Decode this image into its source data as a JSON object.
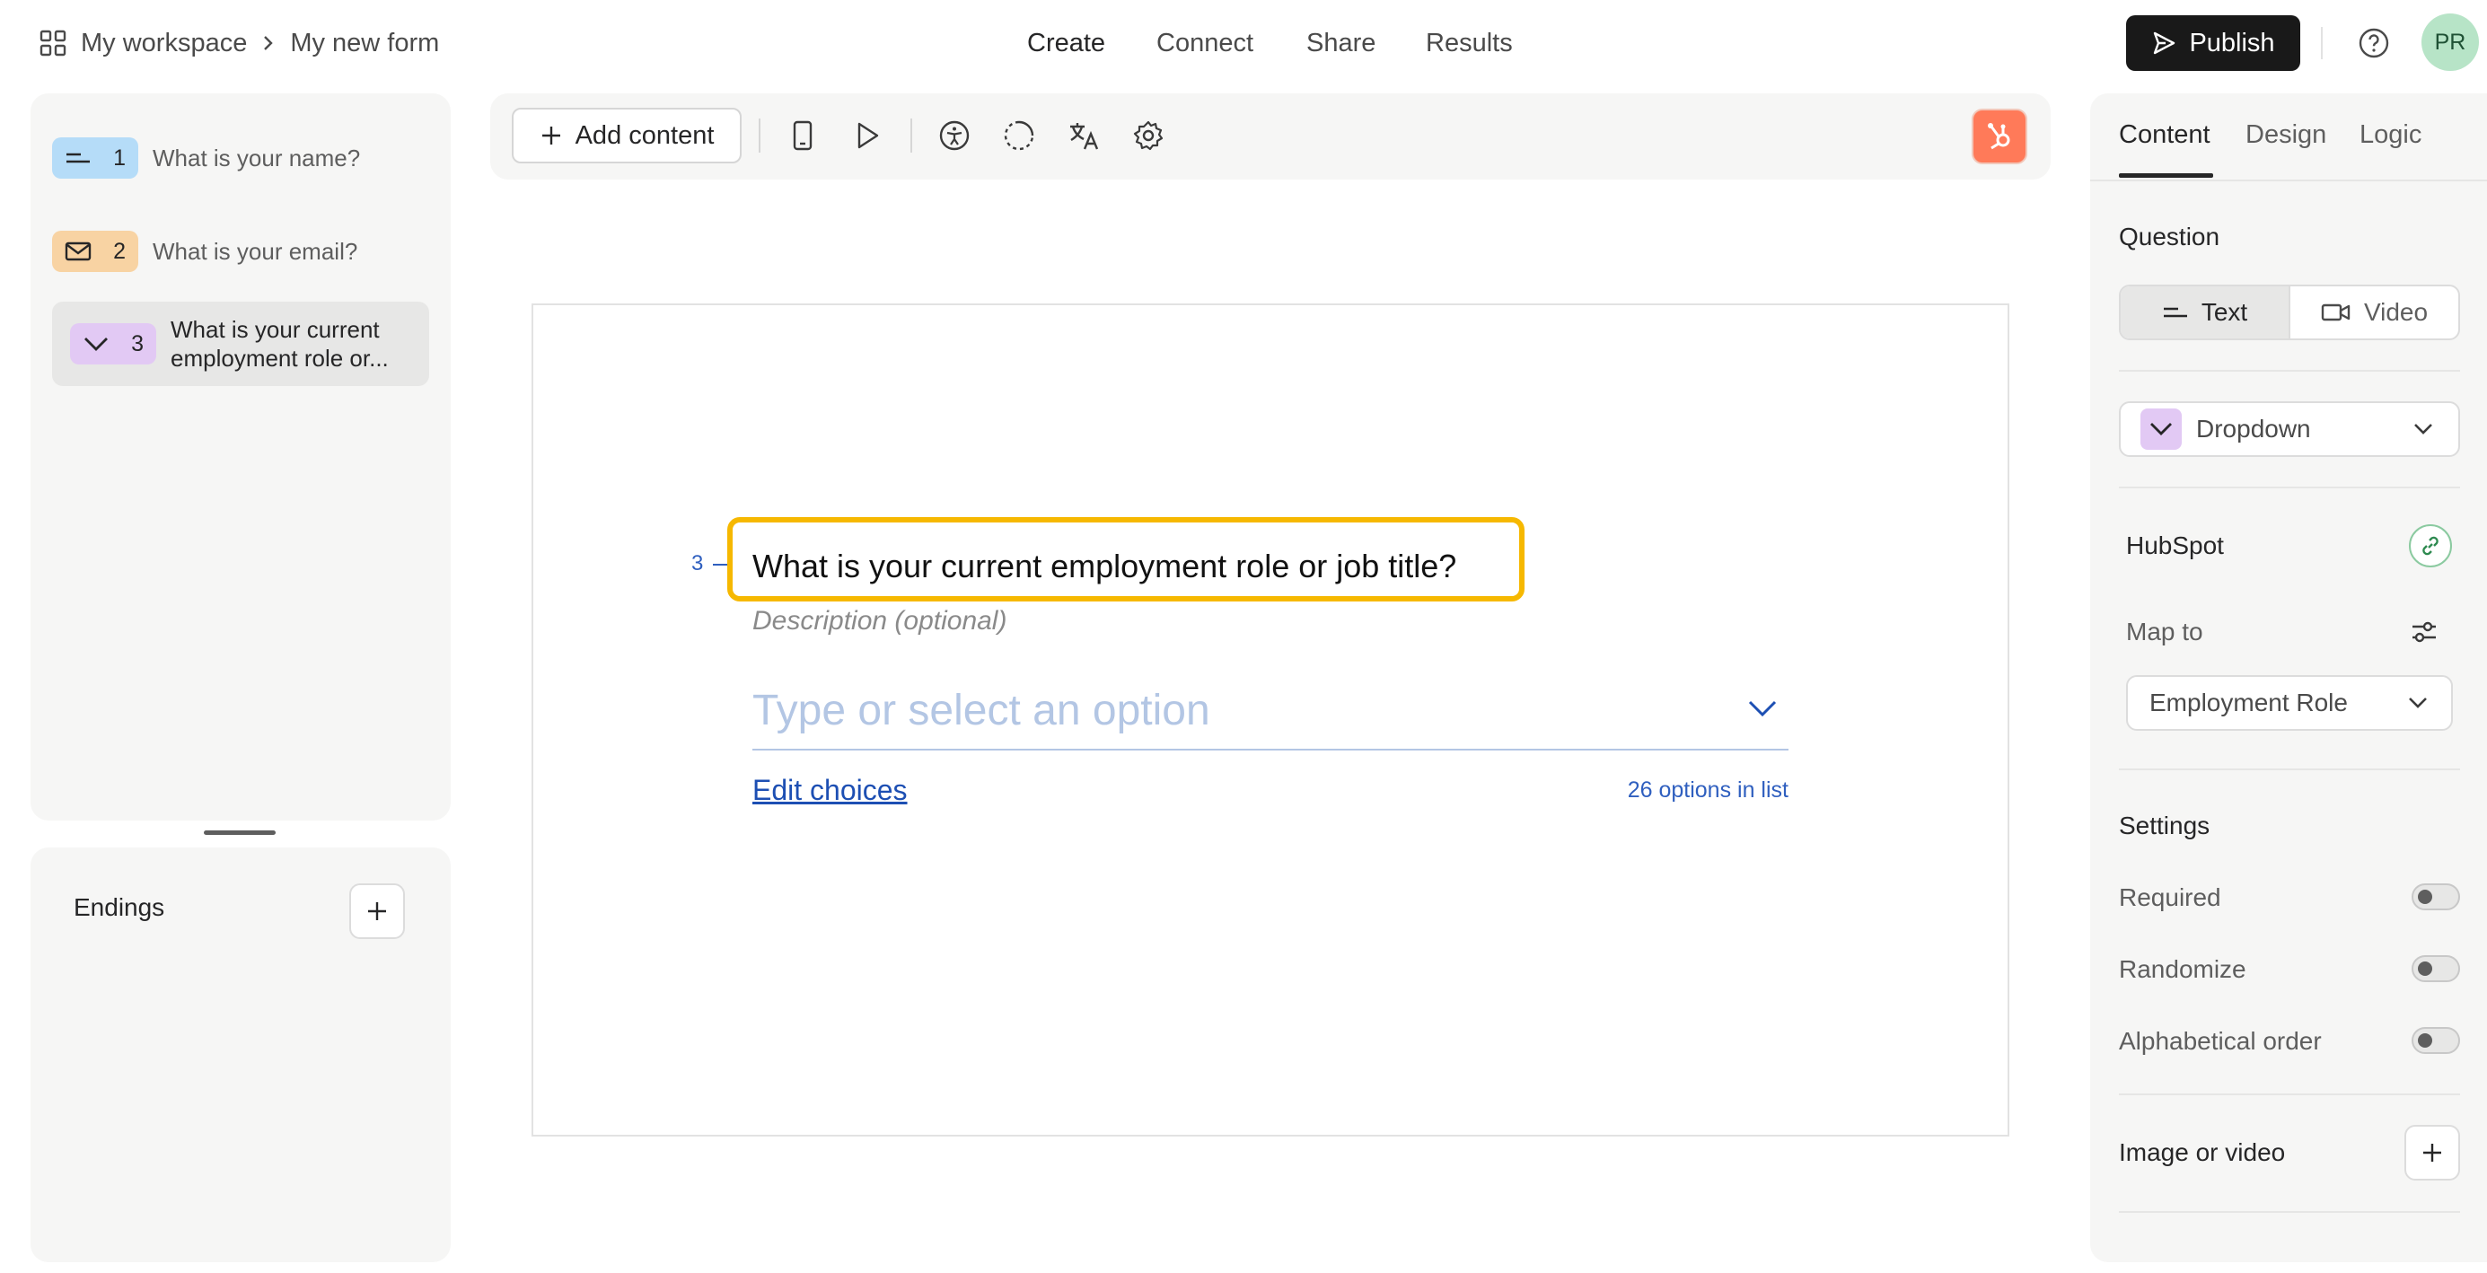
{
  "header": {
    "workspace": "My workspace",
    "form_name": "My new form",
    "nav": [
      "Create",
      "Connect",
      "Share",
      "Results"
    ],
    "active_nav": "Create",
    "publish_label": "Publish",
    "avatar_initials": "PR"
  },
  "questions": [
    {
      "number": "1",
      "title": "What is your name?",
      "icon": "short-text-icon",
      "color": "#b5dcf8"
    },
    {
      "number": "2",
      "title": "What is your email?",
      "icon": "envelope-icon",
      "color": "#f8d3a3"
    },
    {
      "number": "3",
      "title": "What is your current employment role or...",
      "icon": "chevron-down-icon",
      "color": "#e2c9f4",
      "selected": true
    }
  ],
  "endings": {
    "label": "Endings"
  },
  "toolbar": {
    "add_content_label": "Add content",
    "icons": [
      "mobile-preview-icon",
      "play-icon",
      "accessibility-icon",
      "loading-icon",
      "translate-icon",
      "settings-icon",
      "hubspot-icon"
    ]
  },
  "editor": {
    "question_number": "3",
    "question_title": "What is your current employment role or job title?",
    "description_placeholder": "Description (optional)",
    "dropdown_placeholder": "Type or select an option",
    "edit_choices_label": "Edit choices",
    "options_count": "26 options in list"
  },
  "right_panel": {
    "tabs": [
      "Content",
      "Design",
      "Logic"
    ],
    "active_tab": "Content",
    "question_heading": "Question",
    "question_types": [
      "Text",
      "Video"
    ],
    "active_question_type": "Text",
    "question_format": "Dropdown",
    "hubspot": {
      "label": "HubSpot",
      "map_to_label": "Map to",
      "map_to_value": "Employment Role"
    },
    "settings": {
      "heading": "Settings",
      "toggles": [
        {
          "label": "Required",
          "on": false
        },
        {
          "label": "Randomize",
          "on": false
        },
        {
          "label": "Alphabetical order",
          "on": false
        }
      ]
    },
    "image_or_video_label": "Image or video"
  },
  "colors": {
    "accent": "#f6b800",
    "link": "#1d4fb3",
    "hubspot": "#ff7a59",
    "publish_bg": "#191919"
  }
}
